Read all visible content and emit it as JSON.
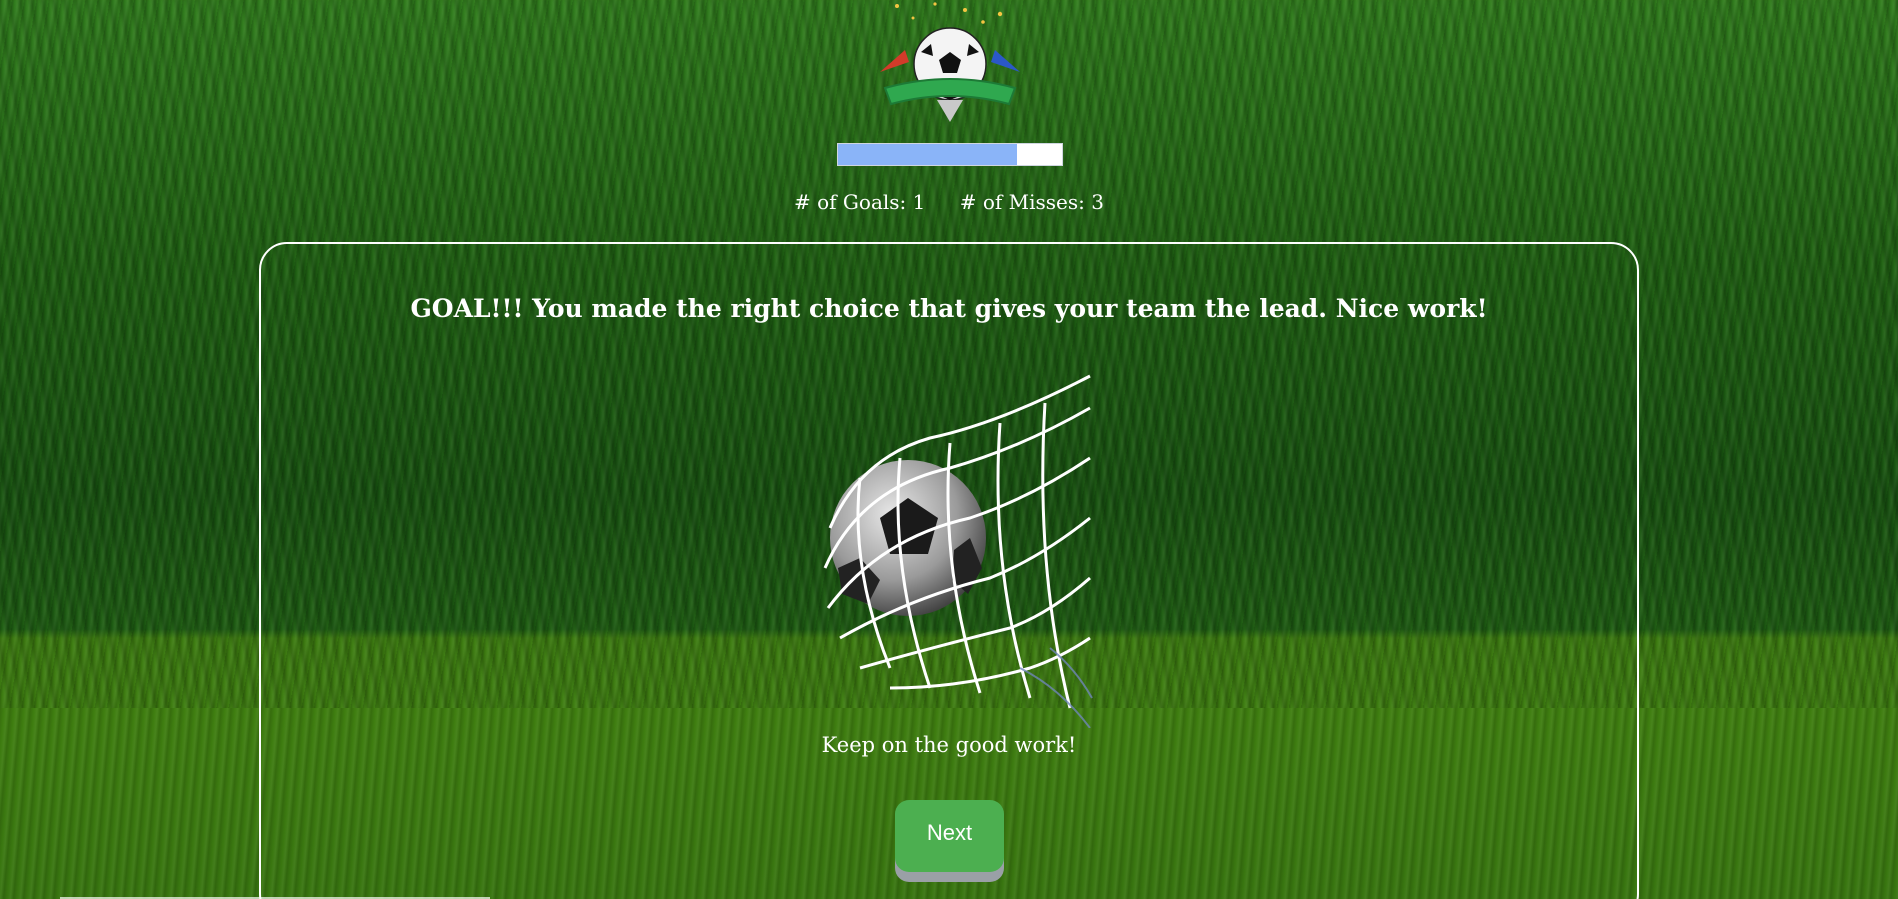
{
  "progress": {
    "value": 0.8
  },
  "stats": {
    "goals": "# of Goals: 1",
    "misses": "# of Misses: 3"
  },
  "result": {
    "headline": "GOAL!!! You made the right choice that gives your team the lead. Nice work!",
    "subtext": "Keep on the good work!"
  },
  "actions": {
    "next_label": "Next"
  },
  "colors": {
    "progress_fill": "#8ab4f8",
    "button": "#4caf50",
    "grass": "#1e5e12"
  },
  "icons": {
    "logo": "soccer-trophy-logo-icon",
    "goal_art": "ball-in-net-icon"
  }
}
